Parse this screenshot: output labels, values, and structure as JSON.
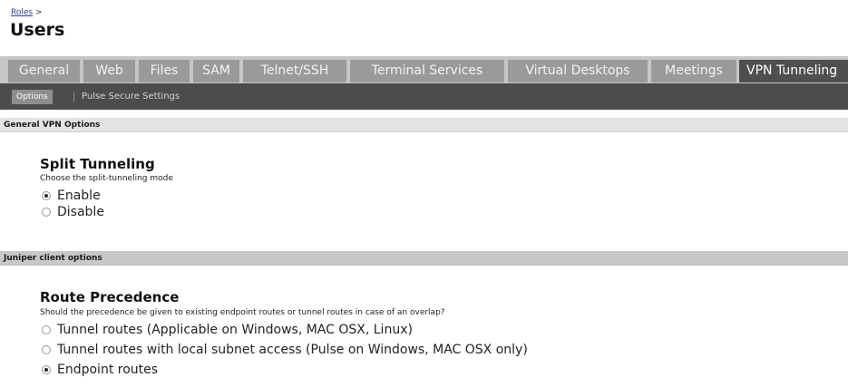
{
  "breadcrumb": {
    "link": "Roles",
    "sep": ">"
  },
  "page": {
    "title": "Users"
  },
  "tabs": [
    {
      "label": "General",
      "active": false
    },
    {
      "label": "Web",
      "active": false
    },
    {
      "label": "Files",
      "active": false
    },
    {
      "label": "SAM",
      "active": false
    },
    {
      "label": "Telnet/SSH",
      "active": false
    },
    {
      "label": "Terminal Services",
      "active": false
    },
    {
      "label": "Virtual Desktops",
      "active": false
    },
    {
      "label": "Meetings",
      "active": false
    },
    {
      "label": "VPN Tunneling",
      "active": true
    }
  ],
  "subtabs": {
    "options": "Options",
    "pulse": "Pulse Secure Settings"
  },
  "sections": {
    "general_vpn": "General VPN Options",
    "juniper_client": "Juniper client options"
  },
  "split_tunneling": {
    "title": "Split Tunneling",
    "desc": "Choose the split-tunneling mode",
    "options": [
      {
        "label": "Enable",
        "checked": true
      },
      {
        "label": "Disable",
        "checked": false
      }
    ]
  },
  "route_precedence": {
    "title": "Route Precedence",
    "desc": "Should the precedence be given to existing endpoint routes or tunnel routes in case of an overlap?",
    "options": [
      {
        "label": "Tunnel routes (Applicable on Windows, MAC OSX, Linux)",
        "checked": false
      },
      {
        "label": "Tunnel routes with local subnet access (Pulse on Windows, MAC OSX only)",
        "checked": false
      },
      {
        "label": "Endpoint routes",
        "checked": true
      }
    ]
  },
  "colors": {
    "tab_inactive": "#9a9a9a",
    "tab_active": "#4f4f4f",
    "subbar": "#4c4c4c",
    "link": "#2a3f9e"
  }
}
